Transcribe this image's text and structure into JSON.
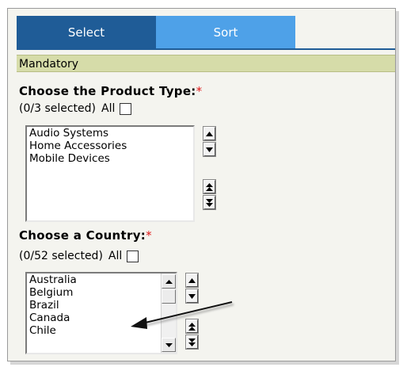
{
  "tabs": [
    {
      "label": "Select",
      "active": true
    },
    {
      "label": "Sort",
      "active": false
    }
  ],
  "section": {
    "label": "Mandatory"
  },
  "product_type": {
    "heading": "Choose the Product Type:",
    "required_mark": "*",
    "count": "(0/3 selected)",
    "all_label": "All",
    "all_checked": false,
    "options": [
      "Audio Systems",
      "Home Accessories",
      "Mobile Devices"
    ]
  },
  "country": {
    "heading": "Choose a Country:",
    "required_mark": "*",
    "count": "(0/52 selected)",
    "all_label": "All",
    "all_checked": false,
    "options": [
      "Australia",
      "Belgium",
      "Brazil",
      "Canada",
      "Chile"
    ]
  },
  "colors": {
    "tab_active": "#1f5c97",
    "tab_inactive": "#4ea1e8",
    "section_bar": "#d6dca9",
    "required": "#e01818"
  }
}
